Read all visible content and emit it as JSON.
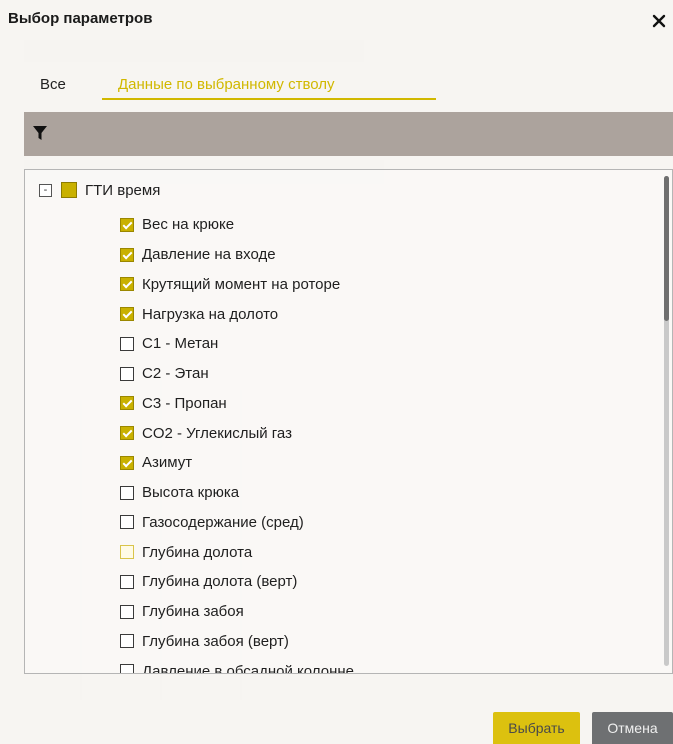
{
  "dialog": {
    "title": "Выбор параметров",
    "close_label": "×"
  },
  "tabs": [
    {
      "label": "Все",
      "active": false
    },
    {
      "label": "Данные по выбранному стволу",
      "active": true
    }
  ],
  "tree": {
    "expander_symbol": "-",
    "root_label": "ГТИ время",
    "items": [
      {
        "label": "Вес на крюке",
        "checked": true
      },
      {
        "label": "Давление на входе",
        "checked": true
      },
      {
        "label": "Крутящий момент на роторе",
        "checked": true
      },
      {
        "label": "Нагрузка на долото",
        "checked": true
      },
      {
        "label": "C1 - Метан",
        "checked": false
      },
      {
        "label": "C2 - Этан",
        "checked": false
      },
      {
        "label": "C3 - Пропан",
        "checked": true
      },
      {
        "label": "CO2 - Углекислый газ",
        "checked": true
      },
      {
        "label": "Азимут",
        "checked": true
      },
      {
        "label": "Высота крюка",
        "checked": false
      },
      {
        "label": "Газосодержание (сред)",
        "checked": false
      },
      {
        "label": "Глубина долота",
        "checked": false,
        "hover": true
      },
      {
        "label": "Глубина долота (верт)",
        "checked": false
      },
      {
        "label": "Глубина забоя",
        "checked": false
      },
      {
        "label": "Глубина забоя (верт)",
        "checked": false
      },
      {
        "label": "Давление в обсадной колонне",
        "checked": false
      }
    ]
  },
  "buttons": {
    "select_label": "Выбрать",
    "cancel_label": "Отмена"
  },
  "colors": {
    "accent": "#d1b800",
    "checkbox_checked": "#c9b100",
    "filter_bar": "#aca39d",
    "cancel_button": "#6e7072"
  },
  "icons": {
    "close": "close-icon",
    "filter": "filter-icon"
  }
}
